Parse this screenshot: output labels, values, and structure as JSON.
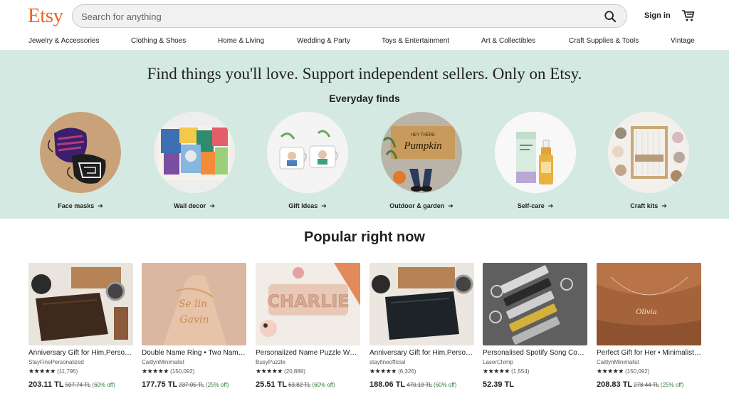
{
  "header": {
    "logo": "Etsy",
    "search_placeholder": "Search for anything",
    "signin_label": "Sign in"
  },
  "nav": [
    "Jewelry & Accessories",
    "Clothing & Shoes",
    "Home & Living",
    "Wedding & Party",
    "Toys & Entertainment",
    "Art & Collectibles",
    "Craft Supplies & Tools",
    "Vintage"
  ],
  "hero": {
    "title": "Find things you'll love. Support independent sellers. Only on Etsy.",
    "subtitle": "Everyday finds",
    "finds": [
      {
        "label": "Face masks",
        "icon": "arrow-right-icon"
      },
      {
        "label": "Wall decor",
        "icon": "arrow-right-icon"
      },
      {
        "label": "Gift Ideas",
        "icon": "arrow-right-icon"
      },
      {
        "label": "Outdoor & garden",
        "icon": "arrow-right-icon"
      },
      {
        "label": "Self-care",
        "icon": "arrow-right-icon"
      },
      {
        "label": "Craft kits",
        "icon": "arrow-right-icon"
      }
    ]
  },
  "popular": {
    "title": "Popular right now",
    "items": [
      {
        "title": "Anniversary Gift for Him,Personalized Wallet",
        "shop": "StayFinePersonalized",
        "stars": "★★★★★",
        "reviews": "(11,795)",
        "price": "203.11 TL",
        "original": "507.74 TL",
        "discount": "(60% off)"
      },
      {
        "title": "Double Name Ring • Two Name Ring",
        "shop": "CaitlynMinimalist",
        "stars": "★★★★★",
        "reviews": "(150,092)",
        "price": "177.75 TL",
        "original": "237.05 TL",
        "discount": "(25% off)"
      },
      {
        "title": "Personalized Name Puzzle Wooden Toy",
        "shop": "BusyPuzzle",
        "stars": "★★★★★",
        "reviews": "(20,889)",
        "price": "25.51 TL",
        "original": "63.82 TL",
        "discount": "(60% off)"
      },
      {
        "title": "Anniversary Gift for Him,Personalized Wallet",
        "shop": "stayfineofficial",
        "stars": "★★★★★",
        "reviews": "(6,326)",
        "price": "188.06 TL",
        "original": "470.19 TL",
        "discount": "(60% off)"
      },
      {
        "title": "Personalised Spotify Song Code Keychain",
        "shop": "LaserChimp",
        "stars": "★★★★★",
        "reviews": "(1,554)",
        "price": "52.39 TL",
        "original": "",
        "discount": ""
      },
      {
        "title": "Perfect Gift for Her • Minimalist Name Necklace",
        "shop": "CaitlynMinimalist",
        "stars": "★★★★★",
        "reviews": "(150,092)",
        "price": "208.83 TL",
        "original": "278.44 TL",
        "discount": "(25% off)"
      }
    ]
  },
  "colors": {
    "brand": "#F1641E",
    "hero_bg": "#D4E9E2",
    "discount": "#2F7A3A"
  }
}
